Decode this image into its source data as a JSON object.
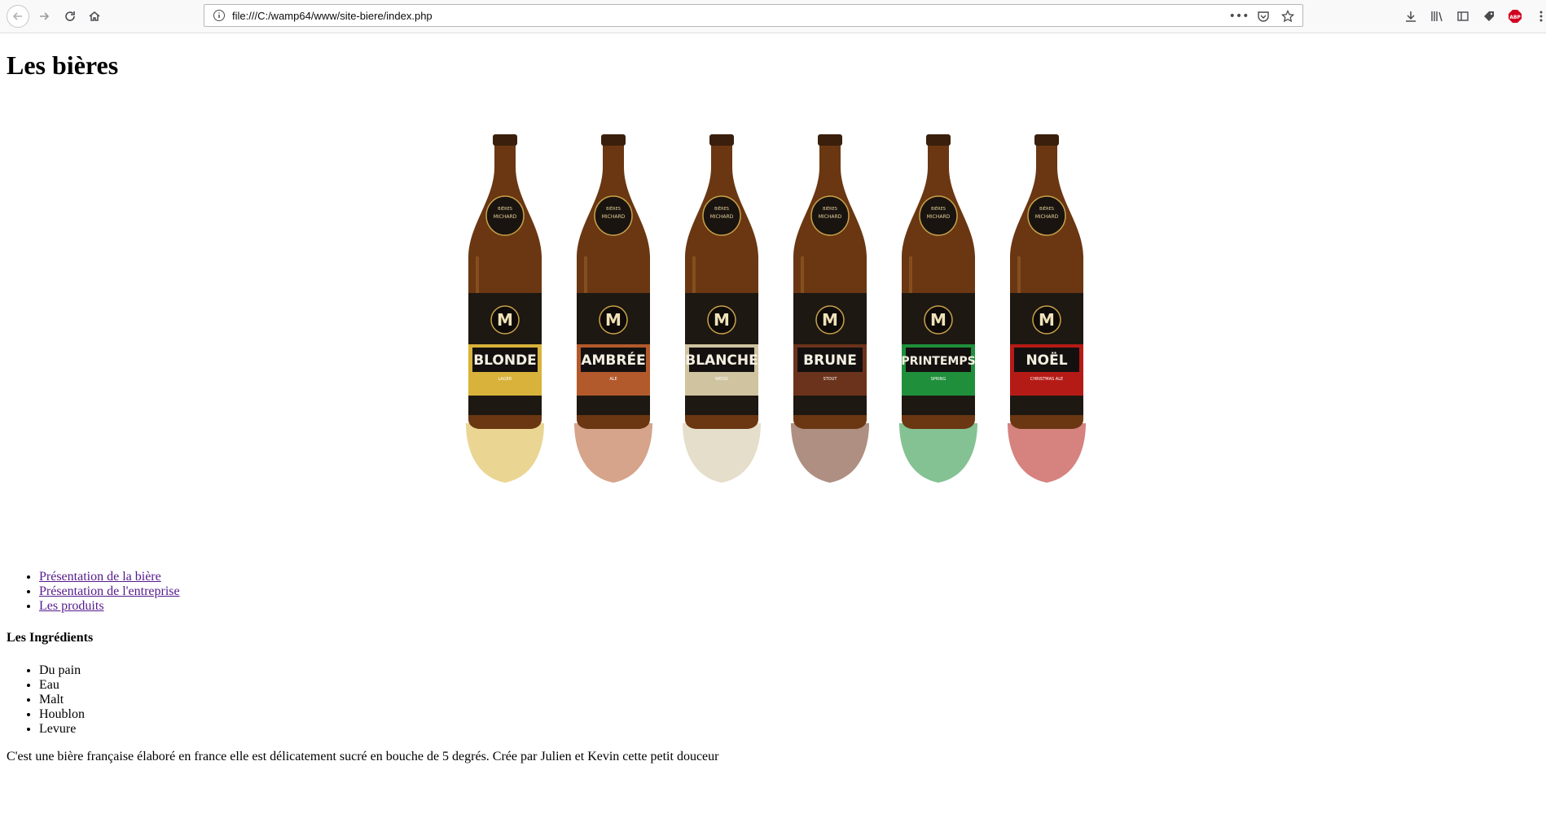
{
  "browser": {
    "url": "file:///C:/wamp64/www/site-biere/index.php",
    "actions": {
      "more": "•••"
    }
  },
  "page": {
    "title": "Les bières",
    "bottles": [
      {
        "brand": "BIÈRES",
        "maker": "MICHARD",
        "name": "BLONDE",
        "type": "LAGER",
        "color": "#d8b23a"
      },
      {
        "brand": "BIÈRES",
        "maker": "MICHARD",
        "name": "AMBRÉE",
        "type": "ALE",
        "color": "#b35a2c"
      },
      {
        "brand": "BIÈRES",
        "maker": "MICHARD",
        "name": "BLANCHE",
        "type": "WEISS",
        "color": "#cfc3a0"
      },
      {
        "brand": "BIÈRES",
        "maker": "MICHARD",
        "name": "BRUNE",
        "type": "STOUT",
        "color": "#6b331b"
      },
      {
        "brand": "BIÈRES",
        "maker": "MICHARD",
        "name": "PRINTEMPS",
        "type": "SPRING",
        "color": "#1f8f3b"
      },
      {
        "brand": "BIÈRES",
        "maker": "MICHARD",
        "name": "NOËL",
        "type": "CHRISTMAS ALE",
        "color": "#b51b16"
      }
    ],
    "nav": [
      "Présentation de la bière",
      "Présentation de l'entreprise",
      "Les produits"
    ],
    "ingredients_title": "Les Ingrédients",
    "ingredients": [
      "Du pain",
      "Eau",
      "Malt",
      "Houblon",
      "Levure"
    ],
    "description": "C'est une bière française élaboré en france elle est délicatement sucré en bouche de 5 degrés. Crée par Julien et Kevin cette petit douceur"
  }
}
